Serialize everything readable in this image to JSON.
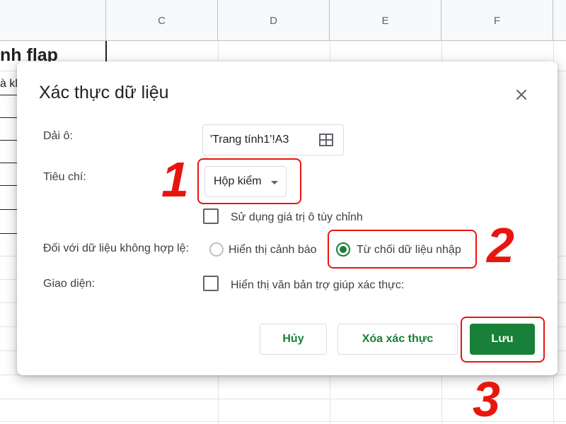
{
  "sheet": {
    "columns": [
      "C",
      "D",
      "E",
      "F"
    ],
    "cell_title": "nh flap",
    "cell_sub": "à kl"
  },
  "dialog": {
    "title": "Xác thực dữ liệu",
    "close_icon": "close-icon",
    "range": {
      "label": "Dải ô:",
      "value": "'Trang tính1'!A3",
      "icon": "grid-select-icon"
    },
    "criteria": {
      "label": "Tiêu chí:",
      "selected": "Hộp kiểm",
      "custom_values_label": "Sử dụng giá trị ô tùy chỉnh",
      "custom_values_checked": false
    },
    "invalid": {
      "label": "Đối với dữ liệu không hợp lệ:",
      "options": [
        "Hiển thị cảnh báo",
        "Từ chối dữ liệu nhập"
      ],
      "selected_index": 1
    },
    "appearance": {
      "label": "Giao diện:",
      "help_text_label": "Hiển thị văn bản trợ giúp xác thực:",
      "help_text_checked": false
    },
    "buttons": {
      "cancel": "Hủy",
      "remove": "Xóa xác thực",
      "save": "Lưu"
    }
  },
  "annotations": {
    "step1": "1",
    "step2": "2",
    "step3": "3"
  },
  "colors": {
    "accent_green": "#188038",
    "annotation_red": "#e8150f"
  }
}
